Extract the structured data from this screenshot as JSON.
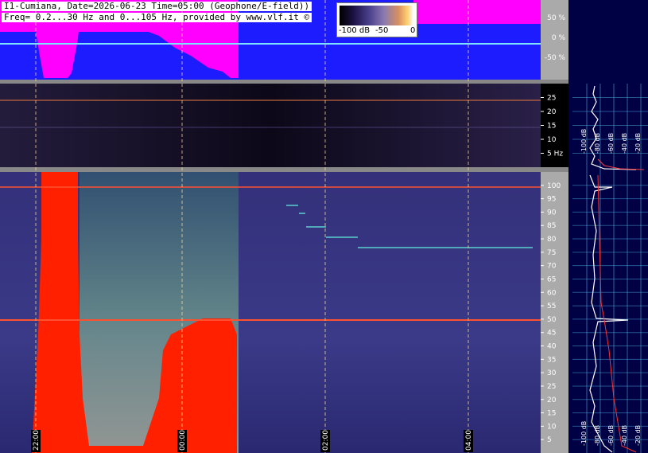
{
  "header": {
    "line1": "I1-Cumiana, Date=2026-06-23 Time=05:00 (Geophone/E-field))",
    "line2": "Freq= 0.2...30 Hz and 0...105 Hz, provided by www.vlf.it ©"
  },
  "colorbar": {
    "labels": [
      "-100 dB",
      "-50",
      "0"
    ]
  },
  "colors": {
    "magenta": "#ff00ff",
    "blue": "#1c1cff",
    "cyan": "#7fe0ff",
    "panel_bg": "#000044",
    "grid": "#4aa8d8",
    "red": "#ff2000"
  },
  "chart_data": [
    {
      "type": "area",
      "panel": "amplitude",
      "y_ticks": [
        "50 %",
        "0 %",
        "-50 %"
      ],
      "ylim": [
        -100,
        100
      ]
    },
    {
      "type": "heatmap",
      "panel": "low-frequency spectrogram",
      "y_unit": "Hz",
      "y_ticks": [
        "25",
        "20",
        "15",
        "10",
        "5 Hz"
      ],
      "ylim": [
        0,
        30
      ],
      "side_plot_labels": [
        "-100 dB",
        "-80 dB",
        "-60 dB",
        "-40 dB",
        "-20 dB"
      ]
    },
    {
      "type": "heatmap",
      "panel": "main spectrogram",
      "y_ticks": [
        "100",
        "95",
        "90",
        "85",
        "80",
        "75",
        "70",
        "65",
        "60",
        "55",
        "50",
        "45",
        "40",
        "35",
        "30",
        "25",
        "20",
        "15",
        "10",
        "5"
      ],
      "ylim": [
        0,
        105
      ],
      "x_ticks": [
        "22:00",
        "00:00",
        "02:00",
        "04:00"
      ],
      "side_plot_labels": [
        "-100 dB",
        "-80 dB",
        "-60 dB",
        "-40 dB",
        "-20 dB"
      ],
      "peaks_hz": [
        50,
        100
      ]
    }
  ]
}
